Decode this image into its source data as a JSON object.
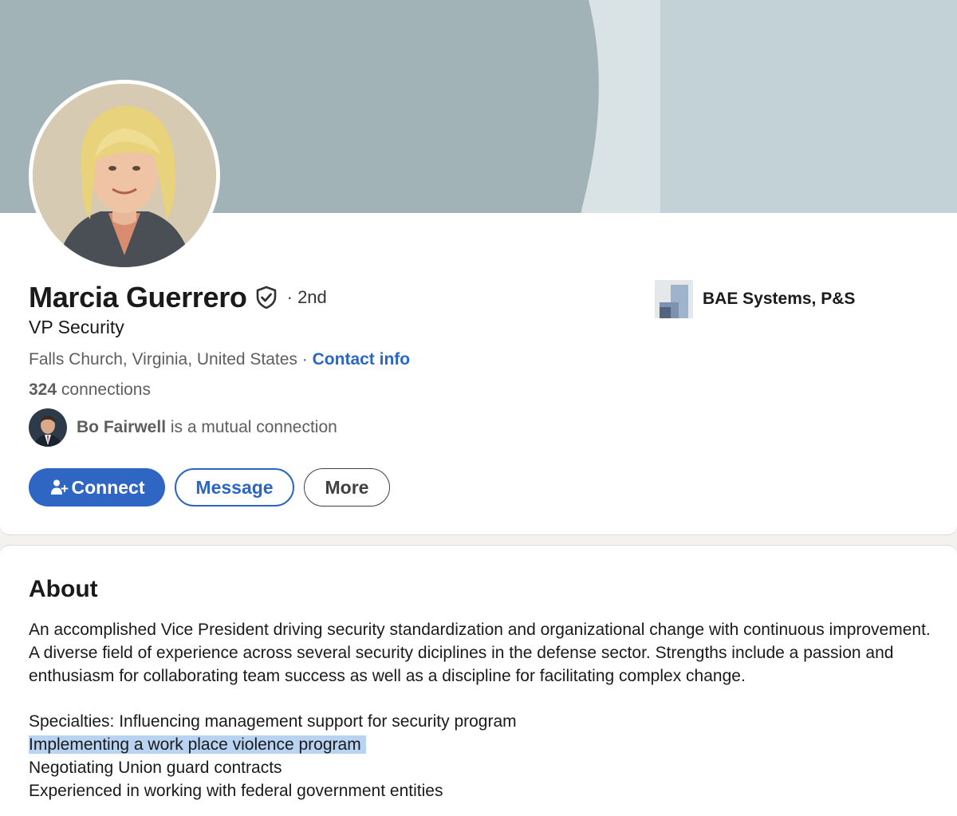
{
  "profile": {
    "name": "Marcia Guerrero",
    "degree": "· 2nd",
    "headline": "VP Security",
    "location": "Falls Church, Virginia, United States",
    "location_separator": "·",
    "contact_info": "Contact info",
    "connections_count": "324",
    "connections_label": "connections",
    "mutual": {
      "name": "Bo Fairwell",
      "text": "is a mutual connection"
    },
    "company": "BAE Systems, P&S"
  },
  "actions": {
    "connect": "Connect",
    "message": "Message",
    "more": "More"
  },
  "about": {
    "title": "About",
    "summary": "An accomplished Vice President driving security standardization and organizational change with continuous improvement. A diverse field of experience across several security diciplines in the defense sector. Strengths include a passion and enthusiasm for collaborating team success as well as a discipline for facilitating complex change.",
    "specialties": [
      "Specialties: Influencing management support for security program",
      "Implementing a work place violence program",
      "Negotiating Union guard contracts",
      "Experienced in working with federal government entities"
    ]
  },
  "colors": {
    "banner_dark": "#a2b3b7",
    "banner_light": "#c3d2d6",
    "accent_blue": "#2a66c2",
    "highlight": "#b9d3f3"
  },
  "icons": {
    "verified": "shield-check-icon",
    "connect": "person-plus-icon",
    "company": "company-logo"
  }
}
